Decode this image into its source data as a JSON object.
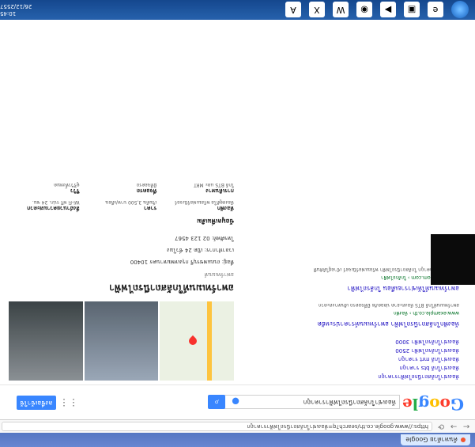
{
  "browser": {
    "tab_label": "ค้นหาด้วย Google",
    "url": "https://www.google.co.th/search?q=ห้องเช่าใกล้สถานีรถไฟฟ้าราคาถูก"
  },
  "google": {
    "query": "ห้องเช่าใกล้สถานีรถไฟฟ้าราคาถูก",
    "signin_label": "ลงชื่อเข้าใช้"
  },
  "results": {
    "suggestions": [
      "ห้องเช่าใกล้สถานีรถไฟฟ้าราคาถูก",
      "ห้องเช่าใกล้ bts ราคาถูก",
      "ห้องเช่าใกล้ mrt ราคาถูก",
      "ห้องเช่าใกล้รถไฟฟ้า 2500",
      "ห้องเช่าใกล้รถไฟฟ้า 3000"
    ],
    "items": [
      {
        "title": "ห้องพักใกล้สถานีรถไฟฟ้า อพาร์ทเมนท์ราคาประหยัด",
        "url": "www.example.co.th › ห้องพัก",
        "snippet": "อพาร์ทเมนท์ใกล้ BTS ห้องสะอาด ปลอดภัย มีที่จอดรถ เดินทางสะดวก"
      },
      {
        "title": "อพาร์ทเมนท์ให้เช่ารายเดือน ใกล้รถไฟฟ้า",
        "url": "www.rent-room.com › ใกล้รถไฟฟ้า",
        "snippet": "รวมห้องเช่าราคาถูก ใกล้สถานีรถไฟฟ้า พร้อมเฟอร์นิเจอร์ เข้าอยู่ได้ทันที"
      }
    ]
  },
  "knowledge_panel": {
    "title": "อพาร์ทเมนท์ใกล้สถานีรถไฟฟ้า",
    "subtitle": "อพาร์ทเมนท์",
    "address": "ที่อยู่: ถนนเพชรบุรี กรุงเทพมหานคร 10400",
    "hours": "เวลาทำการ: เปิด 24 ชั่วโมง",
    "phone": "โทรศัพท์: 02 123 4567",
    "section_title": "ข้อมูลเพิ่มเติม",
    "grid": [
      {
        "h": "ห้องพัก",
        "t": "ห้องสตูดิโอ พร้อมเฟอร์นิเจอร์"
      },
      {
        "h": "ราคา",
        "t": "เริ่มต้น 3,500 บาท/เดือน"
      },
      {
        "h": "สิ่งอำนวยความสะดวก",
        "t": "Wi-Fi ฟรี รปภ. 24 ชม."
      },
      {
        "h": "การเดินทาง",
        "t": "ใกล้ BTS และ MRT"
      },
      {
        "h": "ที่จอดรถ",
        "t": "มีที่จอดรถ"
      },
      {
        "h": "รีวิว",
        "t": "ดูรีวิวทั้งหมด"
      }
    ]
  },
  "taskbar": {
    "clock": "10:45",
    "date": "26/12/2557"
  }
}
